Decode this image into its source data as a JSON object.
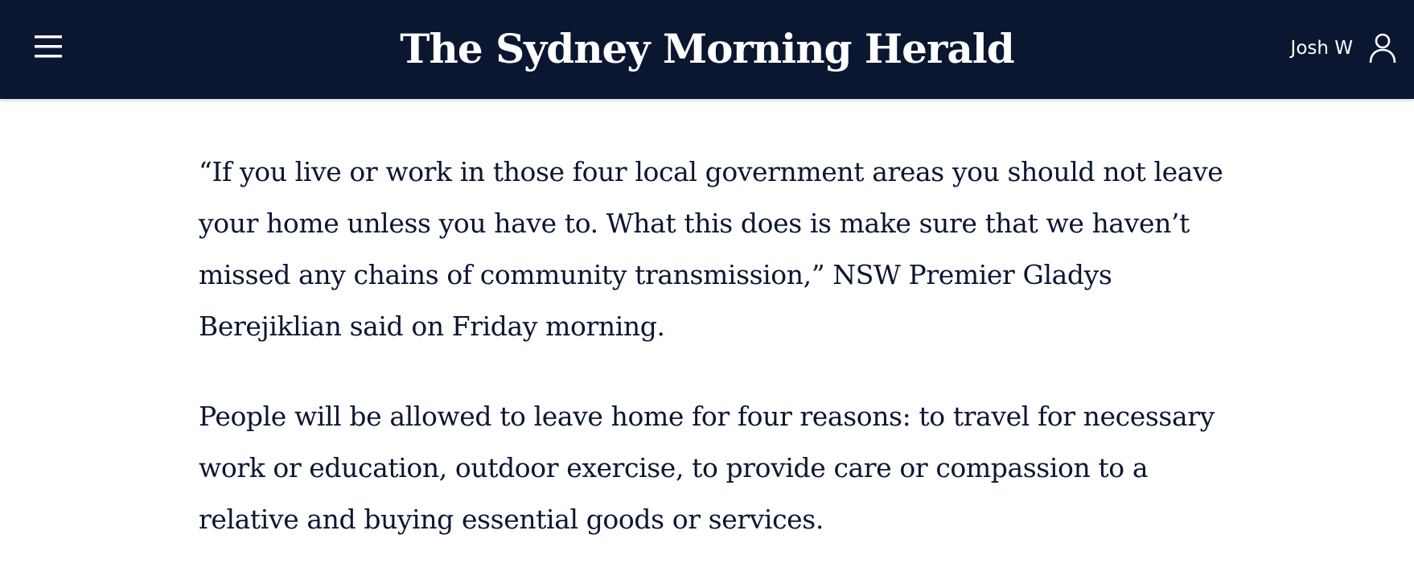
{
  "header": {
    "masthead": "The Sydney Morning Herald",
    "user_name": "Josh W",
    "background_color": "#0b1631",
    "menu_icon": "hamburger-menu-icon",
    "user_icon": "user-account-icon"
  },
  "article": {
    "paragraphs": [
      "“If you live or work in those four local government areas you should not leave your home unless you have to. What this does is make sure that we haven’t missed any chains of community transmission,” NSW Premier Gladys Berejiklian said on Friday morning.",
      "People will be allowed to leave home for four reasons: to travel for necessary work or education, outdoor exercise, to provide care or compassion to a relative and buying essential goods or services."
    ],
    "text_color": "#0b1631"
  }
}
